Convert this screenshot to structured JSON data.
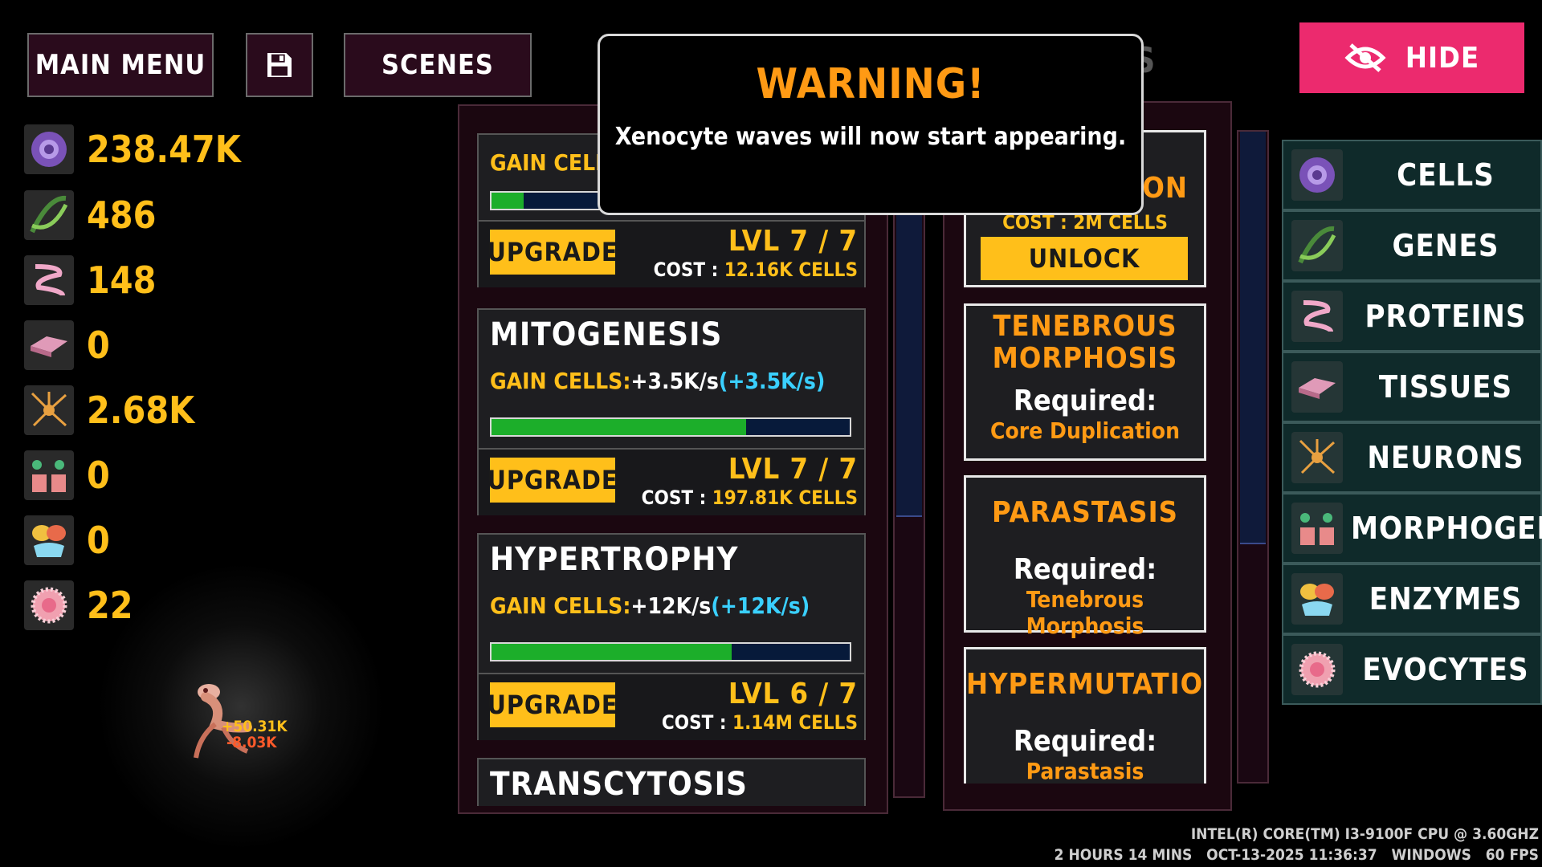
{
  "top_bar": {
    "main_menu": "MAIN MENU",
    "scenes": "SCENES",
    "hide": "HIDE"
  },
  "resources": [
    {
      "name": "cells-icon",
      "value": "238.47K"
    },
    {
      "name": "genes-icon",
      "value": "486"
    },
    {
      "name": "proteins-icon",
      "value": "148"
    },
    {
      "name": "tissues-icon",
      "value": "0"
    },
    {
      "name": "neurons-icon",
      "value": "2.68K"
    },
    {
      "name": "morphogens-icon",
      "value": "0"
    },
    {
      "name": "enzymes-icon",
      "value": "0"
    },
    {
      "name": "evocytes-icon",
      "value": "22"
    }
  ],
  "upgrades": [
    {
      "title": "",
      "gain_label": "GAIN CELLS",
      "gain_value": "",
      "gain_extra": "",
      "progress": 0.09,
      "button": "UPGRADE",
      "level": "LVL 7 / 7",
      "cost_prefix": "COST : ",
      "cost": "12.16K CELLS"
    },
    {
      "title": "MITOGENESIS",
      "gain_label": "GAIN CELLS:",
      "gain_value": "+3.5K/s",
      "gain_extra": "(+3.5K/s)",
      "progress": 0.71,
      "button": "UPGRADE",
      "level": "LVL 7 / 7",
      "cost_prefix": "COST : ",
      "cost": "197.81K CELLS"
    },
    {
      "title": "HYPERTROPHY",
      "gain_label": "GAIN CELLS:",
      "gain_value": "+12K/s",
      "gain_extra": "(+12K/s)",
      "progress": 0.67,
      "button": "UPGRADE",
      "level": "LVL 6 / 7",
      "cost_prefix": "COST : ",
      "cost": "1.14M CELLS"
    },
    {
      "title": "TRANSCYTOSIS"
    }
  ],
  "research": {
    "first": {
      "title_partial": "ON",
      "cost_partial": "COST : 2M CELLS",
      "button": "UNLOCK"
    },
    "cards": [
      {
        "title_line1": "TENEBROUS",
        "title_line2": "MORPHOSIS",
        "required_label": "Required:",
        "required_name": "Core Duplication"
      },
      {
        "title_line1": "PARASTASIS",
        "title_line2": "",
        "required_label": "Required:",
        "required_name": "Tenebrous Morphosis"
      },
      {
        "title_line1": "HYPERMUTATION",
        "title_line2": "",
        "required_label": "Required:",
        "required_name": "Parastasis"
      }
    ]
  },
  "warning": {
    "title": "WARNING!",
    "message": "Xenocyte waves will now start appearing."
  },
  "tabs": [
    {
      "label": "CELLS",
      "icon": "cells-icon"
    },
    {
      "label": "GENES",
      "icon": "genes-icon"
    },
    {
      "label": "PROTEINS",
      "icon": "proteins-icon"
    },
    {
      "label": "TISSUES",
      "icon": "tissues-icon"
    },
    {
      "label": "NEURONS",
      "icon": "neurons-icon"
    },
    {
      "label": "MORPHOGENS",
      "icon": "morphogens-icon"
    },
    {
      "label": "ENZYMES",
      "icon": "enzymes-icon"
    },
    {
      "label": "EVOCYTES",
      "icon": "evocytes-icon"
    }
  ],
  "creature_popups": {
    "gain": "+50.31K",
    "loss": "-8.03K"
  },
  "footer": {
    "cpu": "INTEL(R) CORE(TM) I3-9100F CPU @ 3.60GHZ",
    "status": "2 HOURS 14 MINS   OCT-13-2025 11:36:37   WINDOWS   60 FPS"
  },
  "colors": {
    "accent": "#ffbf1a",
    "title_orange": "#ff9a14",
    "hide_pink": "#ec2a6e",
    "progress_green": "#1cae2a",
    "tab_bg": "#0f2a2a"
  }
}
